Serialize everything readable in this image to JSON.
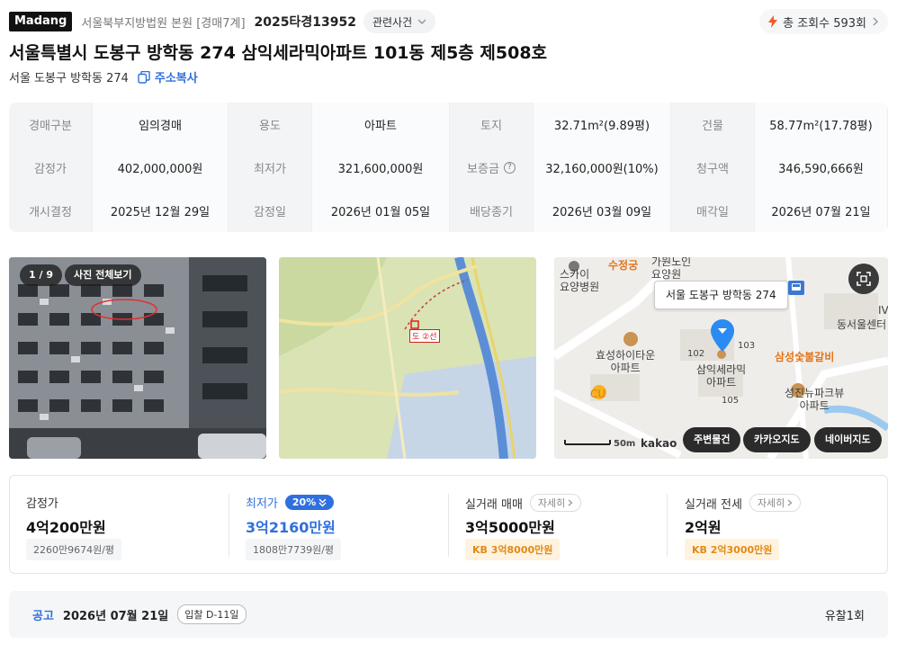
{
  "header": {
    "brand": "Madang",
    "court": "서울북부지방법원 본원 [경매7계]",
    "case_no": "2025타경13952",
    "related": "관련사건",
    "views": "총 조회수 593회"
  },
  "title": "서울특별시 도봉구 방학동 274 삼익세라믹아파트 101동 제5층 제508호",
  "address": {
    "short": "서울 도봉구 방학동 274",
    "copy_label": "주소복사"
  },
  "info": [
    [
      [
        "경매구분",
        "임의경매"
      ],
      [
        "용도",
        "아파트"
      ],
      [
        "토지",
        "32.71m²(9.89평)"
      ],
      [
        "건물",
        "58.77m²(17.78평)"
      ]
    ],
    [
      [
        "감정가",
        "402,000,000원"
      ],
      [
        "최저가",
        "321,600,000원"
      ],
      [
        "보증금",
        "32,160,000원(10%)"
      ],
      [
        "청구액",
        "346,590,666원"
      ]
    ],
    [
      [
        "개시결정",
        "2025년 12월 29일"
      ],
      [
        "감정일",
        "2026년 01월 05일"
      ],
      [
        "배당종기",
        "2026년 03월 09일"
      ],
      [
        "매각일",
        "2026년 07월 21일"
      ]
    ]
  ],
  "photos": {
    "counter": "1 / 9",
    "view_all": "사진 전체보기",
    "map_cadastral_label": "도 ②선"
  },
  "map": {
    "bubble": "서울 도봉구 방학동 274",
    "labels": {
      "suj": "수정궁",
      "nursing": "가원노인\n요양원",
      "sky": "스카이\n요양병원",
      "hs": "효성하이타운\n아파트",
      "samik": "삼익세라믹\n아파트",
      "galbi": "삼성숯불갈비",
      "dongseo": "동서울센터",
      "seongjin": "성진뉴파크뷰\n아파트",
      "cu": "CU",
      "b102": "102",
      "b103": "103",
      "b105": "105",
      "scale": "50m",
      "brand": "kakao",
      "iv": "IV"
    },
    "buttons": [
      "주변물건",
      "카카오지도",
      "네이버지도"
    ]
  },
  "prices": [
    {
      "label": "감정가",
      "value": "4억200만원",
      "sub": "2260만9674원/평"
    },
    {
      "label": "최저가",
      "badge": "20%",
      "value": "3억2160만원",
      "sub": "1808만7739원/평"
    },
    {
      "label": "실거래 매매",
      "detail": "자세히",
      "value": "3억5000만원",
      "sub": "KB 3억8000만원"
    },
    {
      "label": "실거래 전세",
      "detail": "자세히",
      "value": "2억원",
      "sub": "KB 2억3000만원"
    }
  ],
  "notice": {
    "label": "공고",
    "date": "2026년 07월 21일",
    "dday": "입찰 D-11일",
    "result": "유찰1회"
  },
  "colors": {
    "accent": "#2f6fde",
    "kb": "#e28a17",
    "pin": "#2a8bf2",
    "map_orange": "#e2761b"
  }
}
